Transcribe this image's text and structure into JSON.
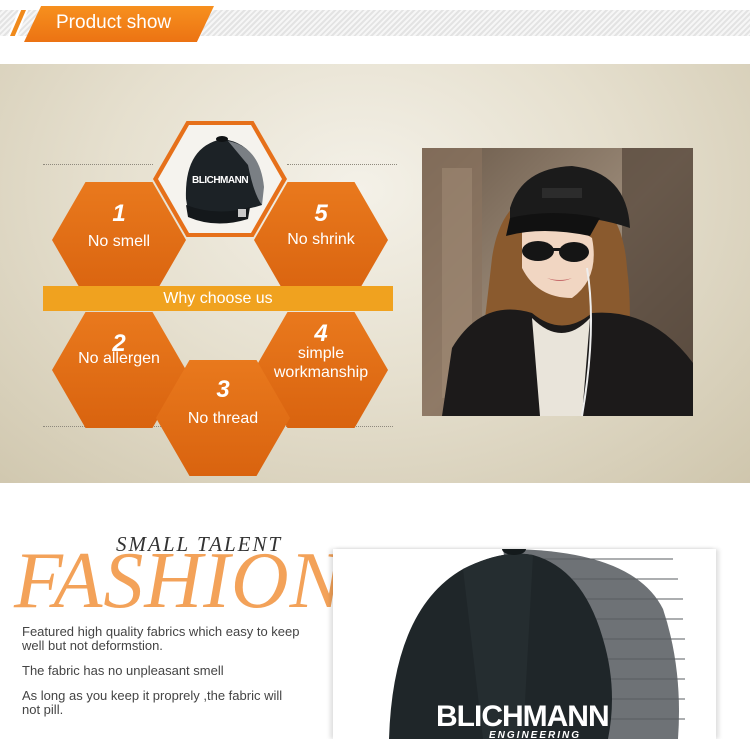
{
  "header": {
    "title": "Product show"
  },
  "features": {
    "center_label": "Why choose us",
    "items": [
      {
        "num": "1",
        "label": "No smell"
      },
      {
        "num": "5",
        "label": "No shrink"
      },
      {
        "num": "2",
        "label": "No allergen"
      },
      {
        "num": "4",
        "label": "simple workmanship"
      },
      {
        "num": "3",
        "label": "No thread"
      }
    ]
  },
  "cap_brand": {
    "name": "BLICHMANN",
    "sub": "ENGINEERING"
  },
  "fashion": {
    "small_title": "SMALL TALENT",
    "big_title": "FASHION",
    "paragraphs": [
      "Featured high quality fabrics which easy to keep well but not deformstion.",
      "The fabric has no unpleasant smell",
      "As long as you keep it proprely ,the fabric will not pill."
    ]
  },
  "colors": {
    "accent": "#ec7313",
    "bar": "#f0a21f",
    "fashion_text": "#f3a259"
  }
}
